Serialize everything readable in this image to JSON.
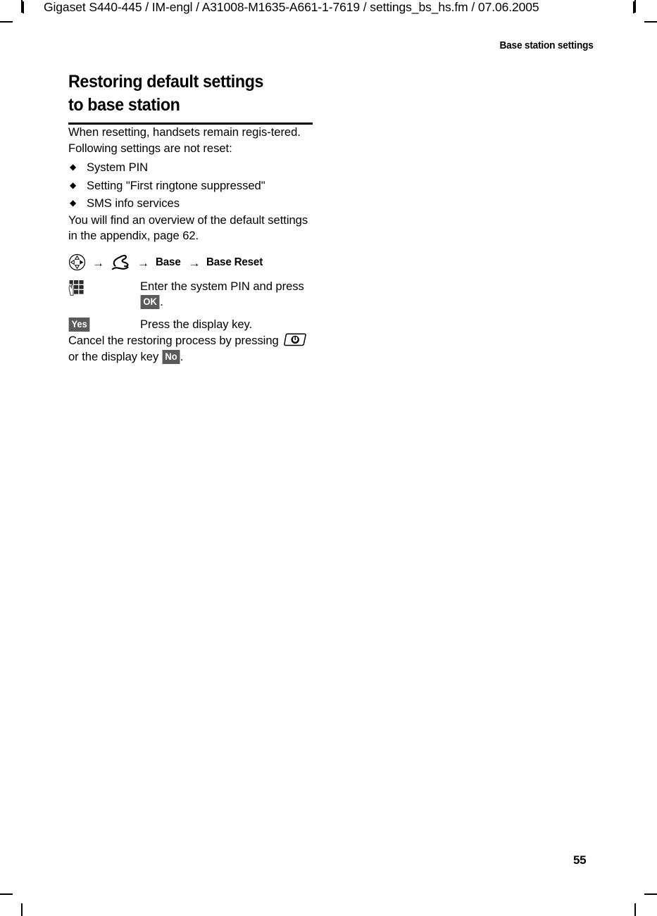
{
  "page": {
    "running_head": "Gigaset S440-445 / IM-engl / A31008-M1635-A661-1-7619 / settings_bs_hs.fm / 07.06.2005",
    "section_header": "Base station settings",
    "page_number": "55"
  },
  "content": {
    "title_line_1": "Restoring default settings",
    "title_line_2": "to base station",
    "intro_paragraph": "When resetting, handsets remain regis-tered. Following settings are not reset:",
    "bullets": [
      {
        "symbol": "◆",
        "text": "System PIN"
      },
      {
        "symbol": "◆",
        "text": "Setting \"First ringtone suppressed\""
      },
      {
        "symbol": "◆",
        "text": "SMS info services"
      }
    ],
    "overview_paragraph": "You will find an overview of the default settings in the appendix, page 62.",
    "nav_path": {
      "icon_1": "navigation-control-icon",
      "arrow": "→",
      "icon_2": "settings-wrench-icon",
      "item_1": "Base",
      "item_2": "Base Reset"
    },
    "instructions": [
      {
        "icon": "keypad-icon",
        "text_part_1": "Enter the system PIN and press ",
        "key": "OK",
        "text_part_2": "."
      },
      {
        "icon": "yes-display-key",
        "key": "Yes",
        "text": "Press the display key."
      }
    ],
    "cancel_paragraph": {
      "text_part_1": "Cancel the restoring process by pressing ",
      "icon": "hangup-key-icon",
      "text_part_2": " or the display key ",
      "key": "No",
      "text_part_3": "."
    }
  },
  "colors": {
    "text": "#000000",
    "badge_background": "#5a5a5a",
    "badge_text": "#ffffff",
    "page_background": "#ffffff"
  }
}
